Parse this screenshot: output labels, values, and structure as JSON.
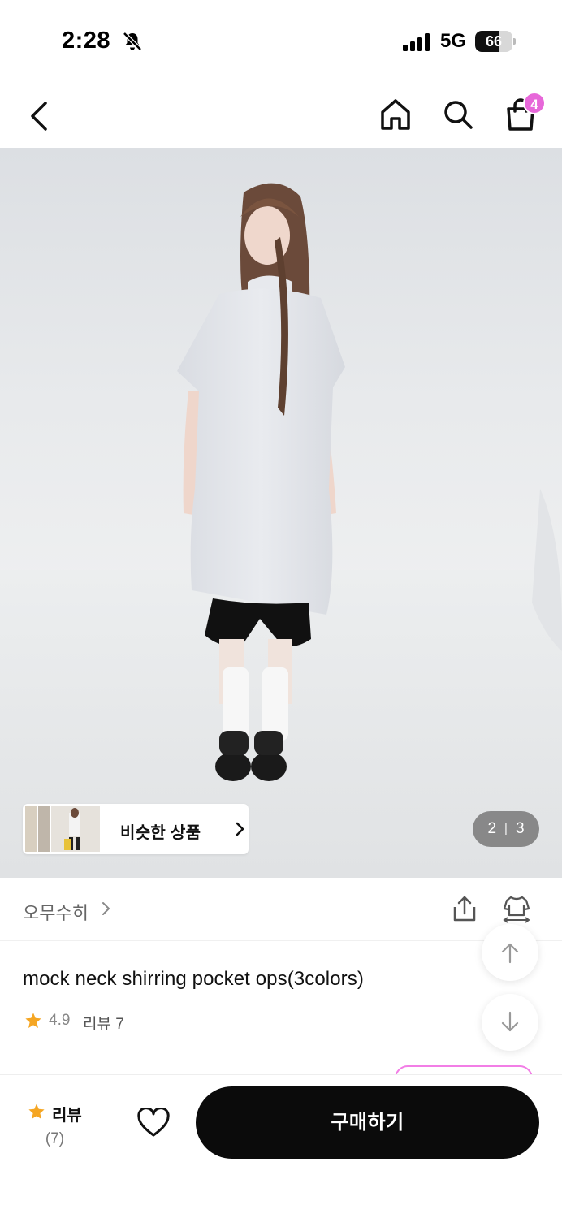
{
  "status_bar": {
    "time": "2:28",
    "network": "5G",
    "battery_level": "66",
    "battery_fraction": 0.66
  },
  "header": {
    "cart_count": "4",
    "icons": [
      "back-icon",
      "home-icon",
      "search-icon",
      "shopping-bag-icon"
    ]
  },
  "gallery": {
    "current_page": "2",
    "separator": "|",
    "total_pages": "3",
    "similar_label": "비슷한 상품"
  },
  "brand": {
    "name": "오무수히",
    "icons": [
      "share-icon",
      "fit-icon"
    ]
  },
  "product": {
    "title": "mock neck shirring pocket ops(3colors)",
    "rating": "4.9",
    "review_link": "리뷰 7"
  },
  "bottom_bar": {
    "review_label": "리뷰",
    "review_count": "(7)",
    "buy_label": "구매하기"
  },
  "colors": {
    "accent_badge": "#e767d9",
    "star": "#f5a623",
    "buy_button": "#0b0b0b"
  }
}
